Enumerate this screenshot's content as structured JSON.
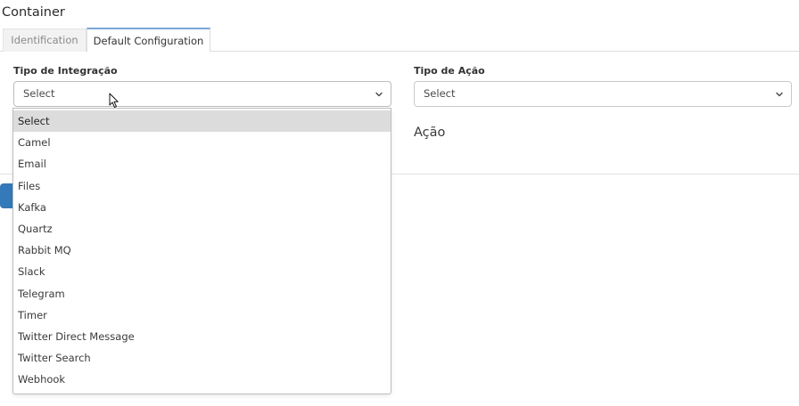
{
  "page": {
    "title": "Container"
  },
  "tabs": [
    {
      "label": "Identification",
      "active": false
    },
    {
      "label": "Default Configuration",
      "active": true
    }
  ],
  "form": {
    "integracao": {
      "label": "Tipo de Integração",
      "value": "Select"
    },
    "acao": {
      "label": "Tipo de Ação",
      "value": "Select"
    },
    "section_heading": "Ação"
  },
  "dropdown": {
    "selected_index": 0,
    "options": [
      "Select",
      "Camel",
      "Email",
      "Files",
      "Kafka",
      "Quartz",
      "Rabbit MQ",
      "Slack",
      "Telegram",
      "Timer",
      "Twitter Direct Message",
      "Twitter Search",
      "Webhook"
    ]
  },
  "icons": {
    "select_arrow": "chevron-down-icon",
    "pointer": "mouse-cursor-icon"
  },
  "colors": {
    "accent": "#3479b9",
    "tab_active_border": "#7aa7d9",
    "option_highlight": "#dcdcdc"
  }
}
